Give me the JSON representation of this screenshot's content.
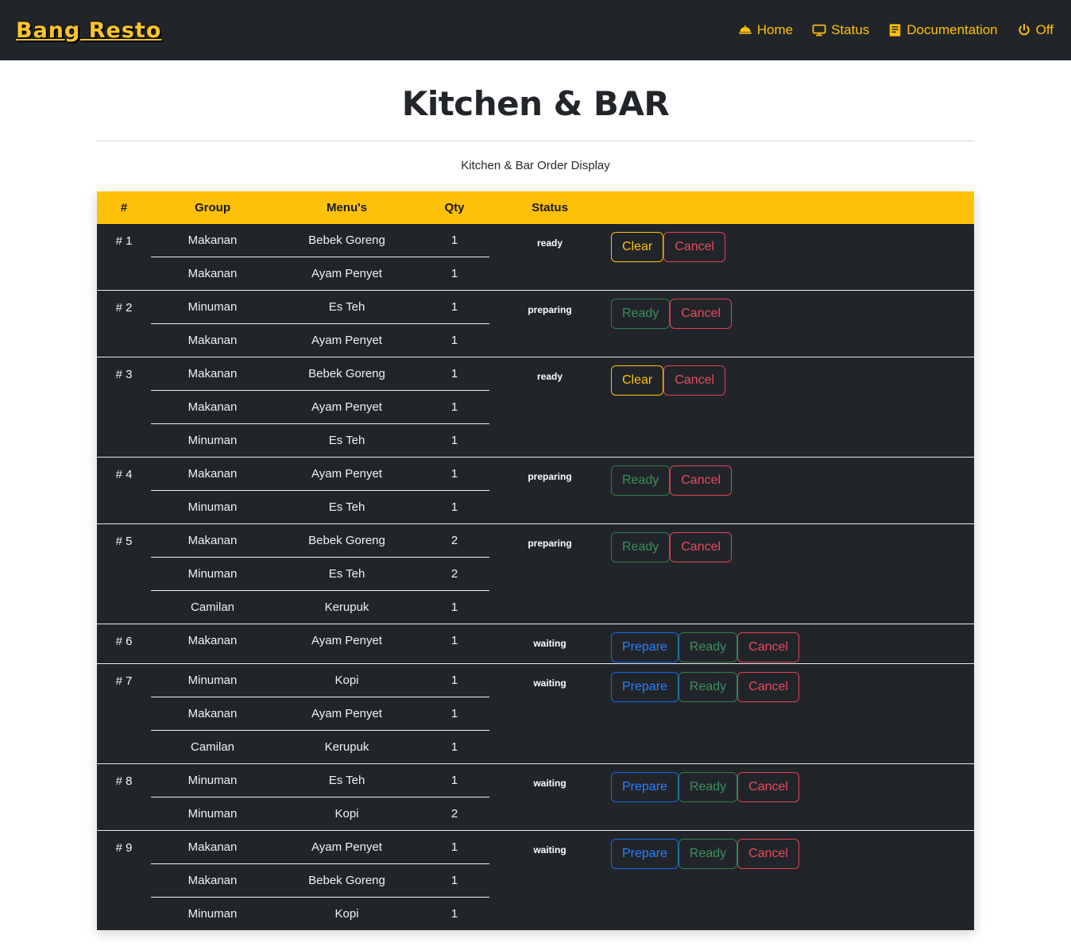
{
  "navbar": {
    "brand": "Bang Resto",
    "links": [
      {
        "label": "Home",
        "icon": "bell-dome-icon"
      },
      {
        "label": "Status",
        "icon": "desktop-icon"
      },
      {
        "label": "Documentation",
        "icon": "book-icon"
      },
      {
        "label": "Off",
        "icon": "power-icon"
      }
    ]
  },
  "page": {
    "title": "Kitchen & BAR",
    "subtitle": "Kitchen & Bar Order Display"
  },
  "table": {
    "headers": {
      "num": "#",
      "group": "Group",
      "menu": "Menu's",
      "qty": "Qty",
      "status": "Status",
      "actions": ""
    },
    "buttons": {
      "clear": "Clear",
      "cancel": "Cancel",
      "ready": "Ready",
      "prepare": "Prepare"
    },
    "rows": [
      {
        "num": "# 1",
        "status": "ready",
        "actions": [
          "clear",
          "cancel"
        ],
        "items": [
          {
            "group": "Makanan",
            "menu": "Bebek Goreng",
            "qty": "1"
          },
          {
            "group": "Makanan",
            "menu": "Ayam Penyet",
            "qty": "1"
          }
        ]
      },
      {
        "num": "# 2",
        "status": "preparing",
        "actions": [
          "ready",
          "cancel"
        ],
        "items": [
          {
            "group": "Minuman",
            "menu": "Es Teh",
            "qty": "1"
          },
          {
            "group": "Makanan",
            "menu": "Ayam Penyet",
            "qty": "1"
          }
        ]
      },
      {
        "num": "# 3",
        "status": "ready",
        "actions": [
          "clear",
          "cancel"
        ],
        "items": [
          {
            "group": "Makanan",
            "menu": "Bebek Goreng",
            "qty": "1"
          },
          {
            "group": "Makanan",
            "menu": "Ayam Penyet",
            "qty": "1"
          },
          {
            "group": "Minuman",
            "menu": "Es Teh",
            "qty": "1"
          }
        ]
      },
      {
        "num": "# 4",
        "status": "preparing",
        "actions": [
          "ready",
          "cancel"
        ],
        "items": [
          {
            "group": "Makanan",
            "menu": "Ayam Penyet",
            "qty": "1"
          },
          {
            "group": "Minuman",
            "menu": "Es Teh",
            "qty": "1"
          }
        ]
      },
      {
        "num": "# 5",
        "status": "preparing",
        "actions": [
          "ready",
          "cancel"
        ],
        "items": [
          {
            "group": "Makanan",
            "menu": "Bebek Goreng",
            "qty": "2"
          },
          {
            "group": "Minuman",
            "menu": "Es Teh",
            "qty": "2"
          },
          {
            "group": "Camilan",
            "menu": "Kerupuk",
            "qty": "1"
          }
        ]
      },
      {
        "num": "# 6",
        "status": "waiting",
        "actions": [
          "prepare",
          "ready",
          "cancel"
        ],
        "items": [
          {
            "group": "Makanan",
            "menu": "Ayam Penyet",
            "qty": "1"
          }
        ]
      },
      {
        "num": "# 7",
        "status": "waiting",
        "actions": [
          "prepare",
          "ready",
          "cancel"
        ],
        "items": [
          {
            "group": "Minuman",
            "menu": "Kopi",
            "qty": "1"
          },
          {
            "group": "Makanan",
            "menu": "Ayam Penyet",
            "qty": "1"
          },
          {
            "group": "Camilan",
            "menu": "Kerupuk",
            "qty": "1"
          }
        ]
      },
      {
        "num": "# 8",
        "status": "waiting",
        "actions": [
          "prepare",
          "ready",
          "cancel"
        ],
        "items": [
          {
            "group": "Minuman",
            "menu": "Es Teh",
            "qty": "1"
          },
          {
            "group": "Minuman",
            "menu": "Kopi",
            "qty": "2"
          }
        ]
      },
      {
        "num": "# 9",
        "status": "waiting",
        "actions": [
          "prepare",
          "ready",
          "cancel"
        ],
        "items": [
          {
            "group": "Makanan",
            "menu": "Ayam Penyet",
            "qty": "1"
          },
          {
            "group": "Makanan",
            "menu": "Bebek Goreng",
            "qty": "1"
          },
          {
            "group": "Minuman",
            "menu": "Kopi",
            "qty": "1"
          }
        ]
      }
    ]
  },
  "colors": {
    "navbar_bg": "#212529",
    "brand": "#ffc52b",
    "accent": "#ffc107",
    "table_bg": "#212529",
    "clear": "#ffc107",
    "cancel": "#e0415a",
    "ready": "#2f7d4f",
    "prepare": "#1768e8"
  }
}
